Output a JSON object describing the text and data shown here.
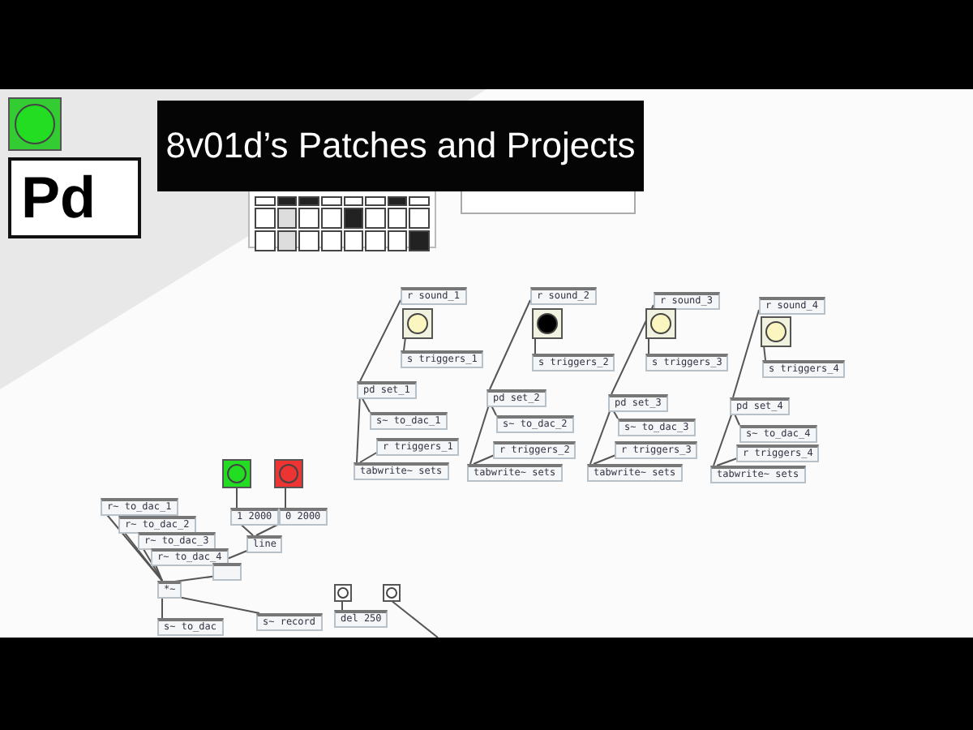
{
  "banner": {
    "title": "8v01d’s Patches and Projects"
  },
  "logo": {
    "text": "Pd"
  },
  "grid": {
    "rows": [
      [
        {
          "kind": "blank"
        },
        {
          "kind": "dark"
        },
        {
          "kind": "dark"
        },
        {
          "kind": "blank"
        },
        {
          "kind": "blank"
        },
        {
          "kind": "blank"
        },
        {
          "kind": "dark"
        },
        {
          "kind": "blank"
        }
      ],
      [
        {
          "kind": "blank"
        },
        {
          "kind": "light"
        },
        {
          "kind": "blank"
        },
        {
          "kind": "blank"
        },
        {
          "kind": "dark"
        },
        {
          "kind": "blank"
        },
        {
          "kind": "blank"
        },
        {
          "kind": "blank"
        }
      ],
      [
        {
          "kind": "blank"
        },
        {
          "kind": "light"
        },
        {
          "kind": "blank"
        },
        {
          "kind": "blank"
        },
        {
          "kind": "blank"
        },
        {
          "kind": "blank"
        },
        {
          "kind": "blank"
        },
        {
          "kind": "dark"
        }
      ]
    ]
  },
  "units": [
    {
      "receive": "r sound_1",
      "flashing": false,
      "send": "s triggers_1",
      "subpatch": "pd set_1",
      "dac": "s~ to_dac_1",
      "triggers": "r triggers_1",
      "table": "tabwrite~ sets"
    },
    {
      "receive": "r sound_2",
      "flashing": true,
      "send": "s triggers_2",
      "subpatch": "pd set_2",
      "dac": "s~ to_dac_2",
      "triggers": "r triggers_2",
      "table": "tabwrite~ sets"
    },
    {
      "receive": "r sound_3",
      "flashing": false,
      "send": "s triggers_3",
      "subpatch": "pd set_3",
      "dac": "s~ to_dac_3",
      "triggers": "r triggers_3",
      "table": "tabwrite~ sets"
    },
    {
      "receive": "r sound_4",
      "flashing": false,
      "send": "s triggers_4",
      "subpatch": "pd set_4",
      "dac": "s~ to_dac_4",
      "triggers": "r triggers_4",
      "table": "tabwrite~ sets"
    }
  ],
  "mixer": {
    "receives": [
      "r~ to_dac_1",
      "r~ to_dac_2",
      "r~ to_dac_3",
      "r~ to_dac_4"
    ],
    "multiply": "*~",
    "send": "s~ to_dac",
    "record": "s~ record",
    "fade_bangs": [
      {
        "color": "#22dd22",
        "message": "1 2000"
      },
      {
        "color": "#ee3333",
        "message": "0 2000"
      }
    ],
    "line": "line",
    "delay": "del 250"
  }
}
